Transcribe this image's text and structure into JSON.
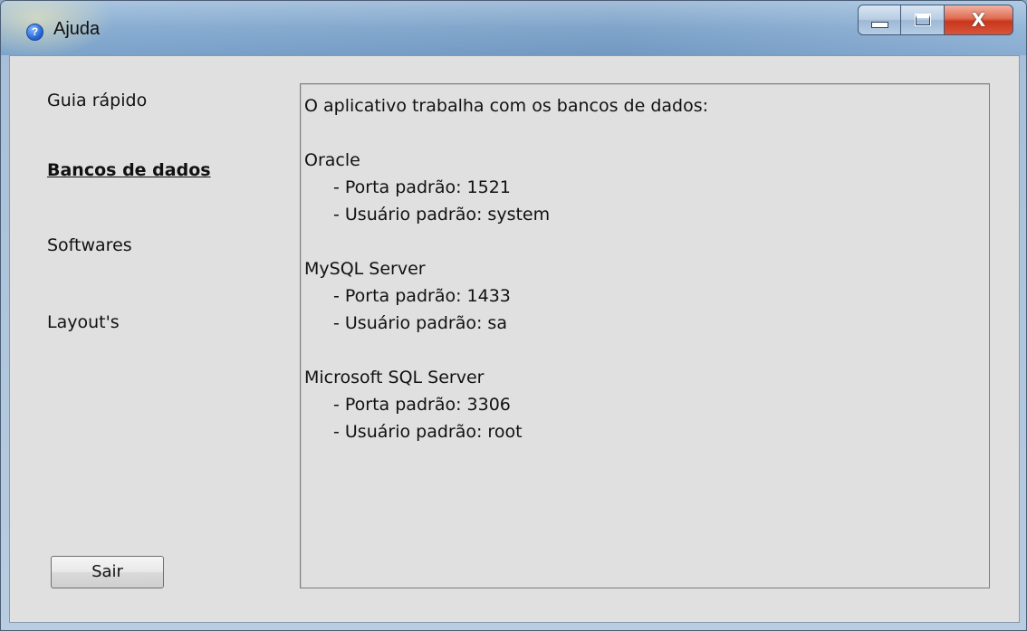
{
  "window": {
    "title": "Ajuda",
    "title_icon": "help-question-icon",
    "controls": {
      "minimize_icon": "minimize-icon",
      "maximize_icon": "maximize-icon",
      "close_icon": "close-icon",
      "close_glyph": "X"
    }
  },
  "sidebar": {
    "items": [
      {
        "label": "Guia rápido",
        "active": false
      },
      {
        "label": "Bancos de dados",
        "active": true
      },
      {
        "label": "Softwares",
        "active": false
      },
      {
        "label": "Layout's",
        "active": false
      }
    ]
  },
  "content": {
    "intro": "O aplicativo trabalha com os bancos de dados:",
    "databases": [
      {
        "name": "Oracle",
        "port": "- Porta padrão: 1521",
        "user": "- Usuário padrão: system"
      },
      {
        "name": "MySQL Server",
        "port": "- Porta padrão: 1433",
        "user": "- Usuário padrão: sa"
      },
      {
        "name": "Microsoft SQL Server",
        "port": "- Porta padrão: 3306",
        "user": "- Usuário padrão: root"
      }
    ]
  },
  "footer": {
    "exit_label": "Sair"
  },
  "colors": {
    "client_bg": "#e0e0e0",
    "close_button": "#c8361b",
    "title_icon": "#1f5fcf"
  }
}
